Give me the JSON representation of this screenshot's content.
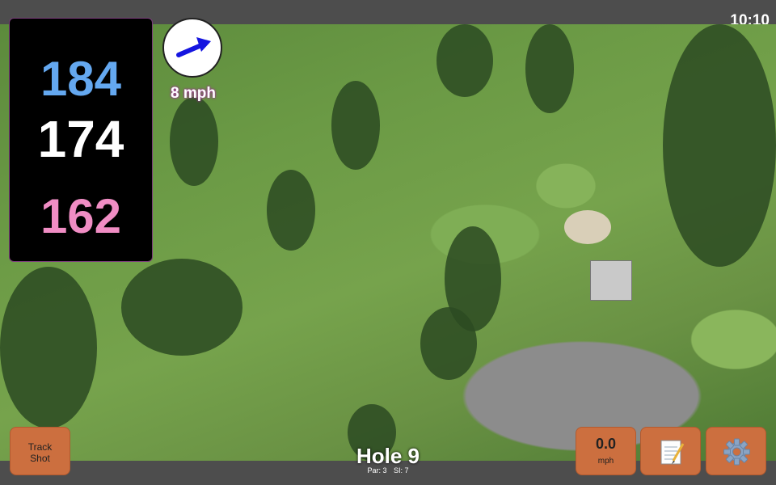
{
  "status_bar": {
    "time": "10:10"
  },
  "distances": {
    "back": "184",
    "center": "174",
    "front": "162"
  },
  "wind": {
    "speed_label": "8 mph",
    "icon": "wind-direction-arrow-icon"
  },
  "buttons": {
    "track_shot_line1": "Track",
    "track_shot_line2": "Shot",
    "wind_value": "0.0",
    "wind_unit": "mph",
    "notes_icon": "notepad-icon",
    "settings_icon": "gear-icon"
  },
  "hole": {
    "title": "Hole 9",
    "par": "Par: 3",
    "si": "SI: 7"
  },
  "colors": {
    "back": "#64a8f0",
    "center": "#ffffff",
    "front": "#f08dc4",
    "button": "#cc6f3f"
  }
}
